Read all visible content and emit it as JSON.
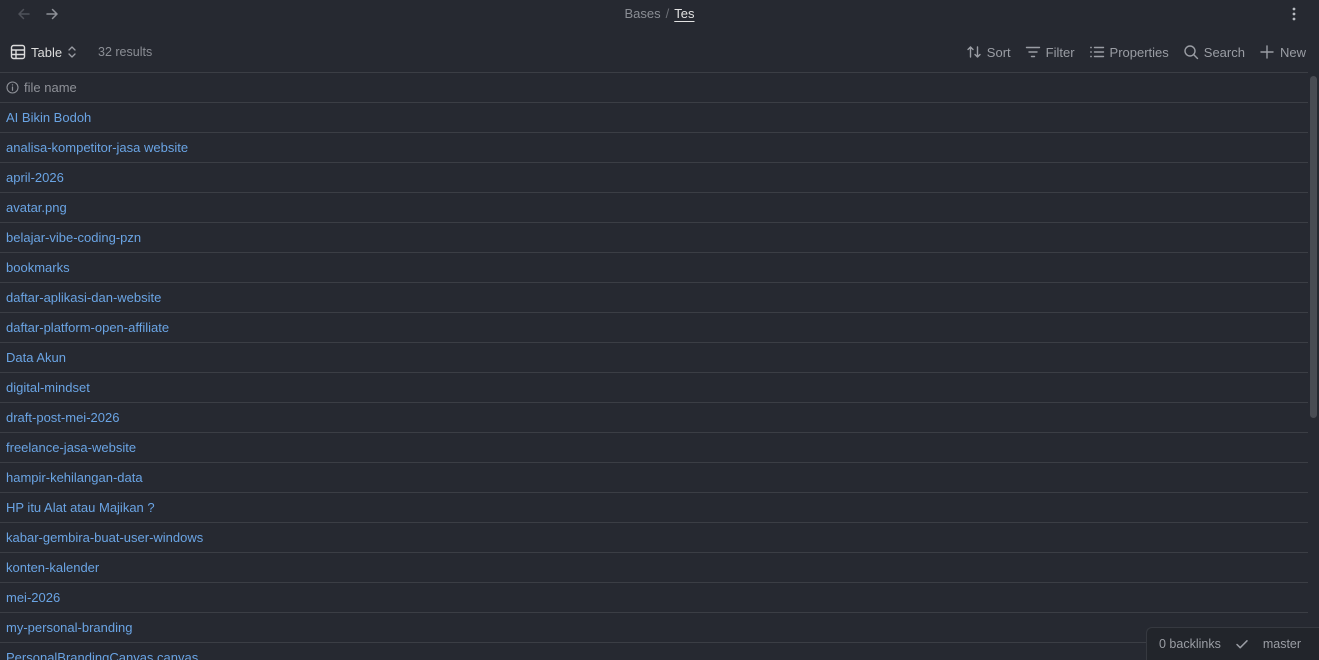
{
  "nav": {
    "back_icon": "arrow-left-icon",
    "forward_icon": "arrow-right-icon"
  },
  "breadcrumb": {
    "parent": "Bases",
    "separator": "/",
    "current": "Tes"
  },
  "toolbar": {
    "view_label": "Table",
    "results": "32 results",
    "sort_label": "Sort",
    "filter_label": "Filter",
    "properties_label": "Properties",
    "search_label": "Search",
    "new_label": "New"
  },
  "table": {
    "column_header": "file name",
    "rows": [
      "AI Bikin Bodoh",
      "analisa-kompetitor-jasa website",
      "april-2026",
      "avatar.png",
      "belajar-vibe-coding-pzn",
      "bookmarks",
      "daftar-aplikasi-dan-website",
      "daftar-platform-open-affiliate",
      "Data Akun",
      "digital-mindset",
      "draft-post-mei-2026",
      "freelance-jasa-website",
      "hampir-kehilangan-data",
      "HP itu Alat atau Majikan ?",
      "kabar-gembira-buat-user-windows",
      "konten-kalender",
      "mei-2026",
      "my-personal-branding",
      "PersonalBrandingCanvas.canvas"
    ]
  },
  "statusbar": {
    "backlinks": "0 backlinks",
    "branch": "master"
  },
  "colors": {
    "background": "#262931",
    "link": "#6aa4e4",
    "muted": "#8e9198",
    "border": "#3b3e45"
  }
}
